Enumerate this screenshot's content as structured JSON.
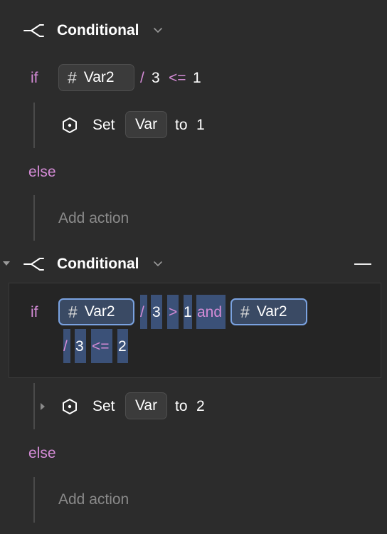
{
  "conditionals": [
    {
      "title": "Conditional",
      "if_keyword": "if",
      "condition": {
        "variable": "Var2",
        "operator_div": "/",
        "divisor": "3",
        "comparator": "<=",
        "value": "1"
      },
      "then_action": {
        "verb": "Set",
        "target": "Var",
        "to_word": "to",
        "value": "1"
      },
      "else_keyword": "else",
      "else_placeholder": "Add action"
    },
    {
      "title": "Conditional",
      "if_keyword": "if",
      "condition": {
        "variable_a": "Var2",
        "operator_div_a": "/",
        "divisor_a": "3",
        "comparator_a": ">",
        "value_a": "1",
        "logical": "and",
        "variable_b": "Var2",
        "operator_div_b": "/",
        "divisor_b": "3",
        "comparator_b": "<=",
        "value_b": "2"
      },
      "then_action": {
        "verb": "Set",
        "target": "Var",
        "to_word": "to",
        "value": "2"
      },
      "else_keyword": "else",
      "else_placeholder": "Add action"
    }
  ],
  "icons": {
    "branch": "branch-icon",
    "chevron": "chevron-down-icon",
    "collapse": "collapse-triangle-icon",
    "set": "hexagon-set-icon",
    "hash": "hash-icon",
    "remove": "minus-icon",
    "expand_row": "expand-triangle-icon"
  },
  "colors": {
    "background": "#2c2c2c",
    "keyword": "#d48bd6",
    "selection": "#3b5178",
    "selected_border": "#7aa2e0",
    "placeholder": "#8a8a8a"
  }
}
